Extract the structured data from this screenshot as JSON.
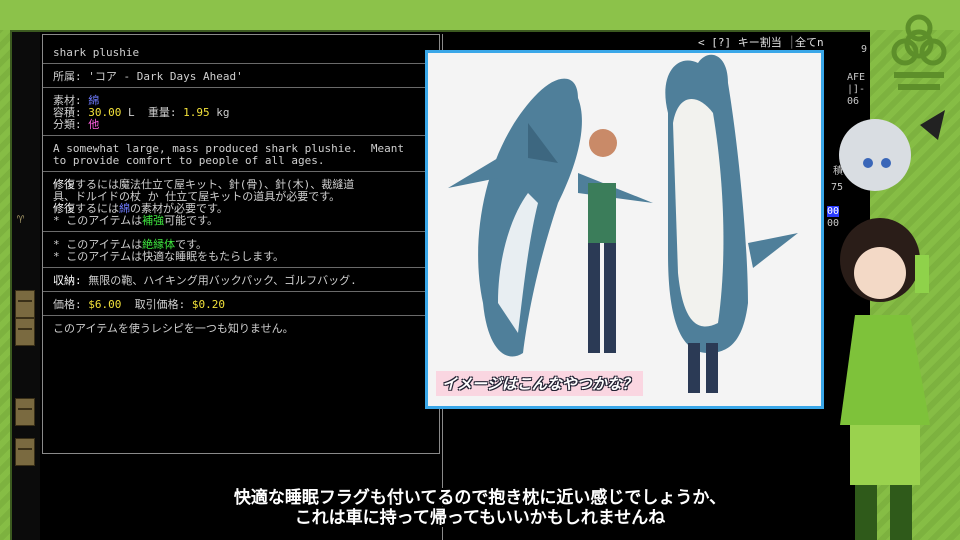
{
  "game": {
    "item_name": "shark plushie",
    "origin": "所属: 'コア - Dark Days Ahead'",
    "material_label": "素材:",
    "material_value": "綿",
    "volume_label": "容積:",
    "volume_value": "30.00",
    "volume_unit": "L",
    "weight_label": "重量:",
    "weight_value": "1.95",
    "weight_unit": "kg",
    "category_label": "分類:",
    "category_value": "他",
    "description_1": "A somewhat large, mass produced shark plushie.  Meant",
    "description_2": "to provide comfort to people of all ages.",
    "repair_1_head": "修復",
    "repair_1_rest": "するには魔法仕立て屋キット、針(骨)、針(木)、裁縫道",
    "repair_2": "具、ドルイドの杖 か 仕立て屋キットの道具が必要です。",
    "repair_3_head": "修復",
    "repair_3_mid": "するには",
    "repair_3_mat": "綿",
    "repair_3_tail": "の素材が必要です。",
    "reinforce_pre": "* このアイテムは",
    "reinforce_key": "補強",
    "reinforce_post": "可能です。",
    "insulator_pre": "* このアイテムは",
    "insulator_key": "絶縁体",
    "insulator_post": "です。",
    "sleep_line": "* このアイテムは快適な睡眠をもたらします。",
    "storage_head": "収納:",
    "storage_rest": " 無限の鞄、ハイキング用バックパック、ゴルフバッグ.",
    "price_head": "価格:",
    "price_value": "$6.00",
    "trade_head": "取引価格:",
    "trade_value": "$0.20",
    "recipe_line": "このアイテムを使うレシピを一つも知りません。",
    "header_keys": "< [?] キー割当 ",
    "header_more": "全てn",
    "side_a": "9",
    "side_b": "AFE",
    "side_c": "|]-",
    "side_d": "06",
    "side_e": "75",
    "side_f": "00",
    "side_g": "00",
    "side_h": "積"
  },
  "overlay": {
    "caption": "イメージはこんなやつかな？"
  },
  "subtitles": {
    "line1": "快適な睡眠フラグも付いてるので抱き枕に近い感じでしょうか、",
    "line2": "これは車に持って帰ってもいいかもしれませんね"
  },
  "colors": {
    "frame_green": "#7fb640",
    "photo_border": "#3aa7e8",
    "material_blue": "#6f7cff",
    "value_yellow": "#f3e23a",
    "category_magenta": "#ff5fe0",
    "positive_green": "#3fe63f"
  },
  "icons": [
    "biohazard-icon",
    "goblet-icon"
  ]
}
